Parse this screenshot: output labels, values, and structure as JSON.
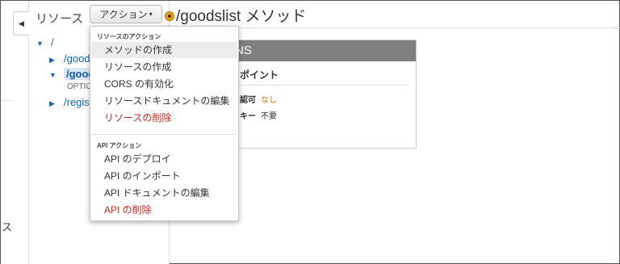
{
  "sidebar": {
    "collapse_glyph": "◀",
    "partial_text": "ス"
  },
  "resources": {
    "title": "リソース",
    "tree": [
      {
        "label": "/",
        "expanded": true
      },
      {
        "label": "/goods",
        "expanded": false
      },
      {
        "label": "/good",
        "expanded": true,
        "selected": true
      },
      {
        "label": "OPTIO",
        "method": true
      },
      {
        "label": "/regist",
        "expanded": false
      }
    ]
  },
  "actions_button": {
    "label": "アクション",
    "caret": "▾"
  },
  "header": {
    "title": "/goodslist メソッド"
  },
  "options_card": {
    "heading": "NS",
    "endpoint_label": "ポイント",
    "auth_label": "認可",
    "auth_value": "なし",
    "key_label": "キー",
    "key_value": "不要"
  },
  "menu": {
    "resource_section": "リソースのアクション",
    "resource_items": [
      {
        "label": "メソッドの作成",
        "hover": true
      },
      {
        "label": "リソースの作成"
      },
      {
        "label": "CORS の有効化"
      },
      {
        "label": "リソースドキュメントの編集"
      },
      {
        "label": "リソースの削除",
        "danger": true
      }
    ],
    "api_section": "API アクション",
    "api_items": [
      {
        "label": "API のデプロイ"
      },
      {
        "label": "API のインポート"
      },
      {
        "label": "API ドキュメントの編集"
      },
      {
        "label": "API の削除",
        "danger": true
      }
    ]
  },
  "colors": {
    "danger": "#d0231b",
    "link": "#1166bb",
    "card_header": "#7f7f7f",
    "accent_orange": "#e07000"
  }
}
